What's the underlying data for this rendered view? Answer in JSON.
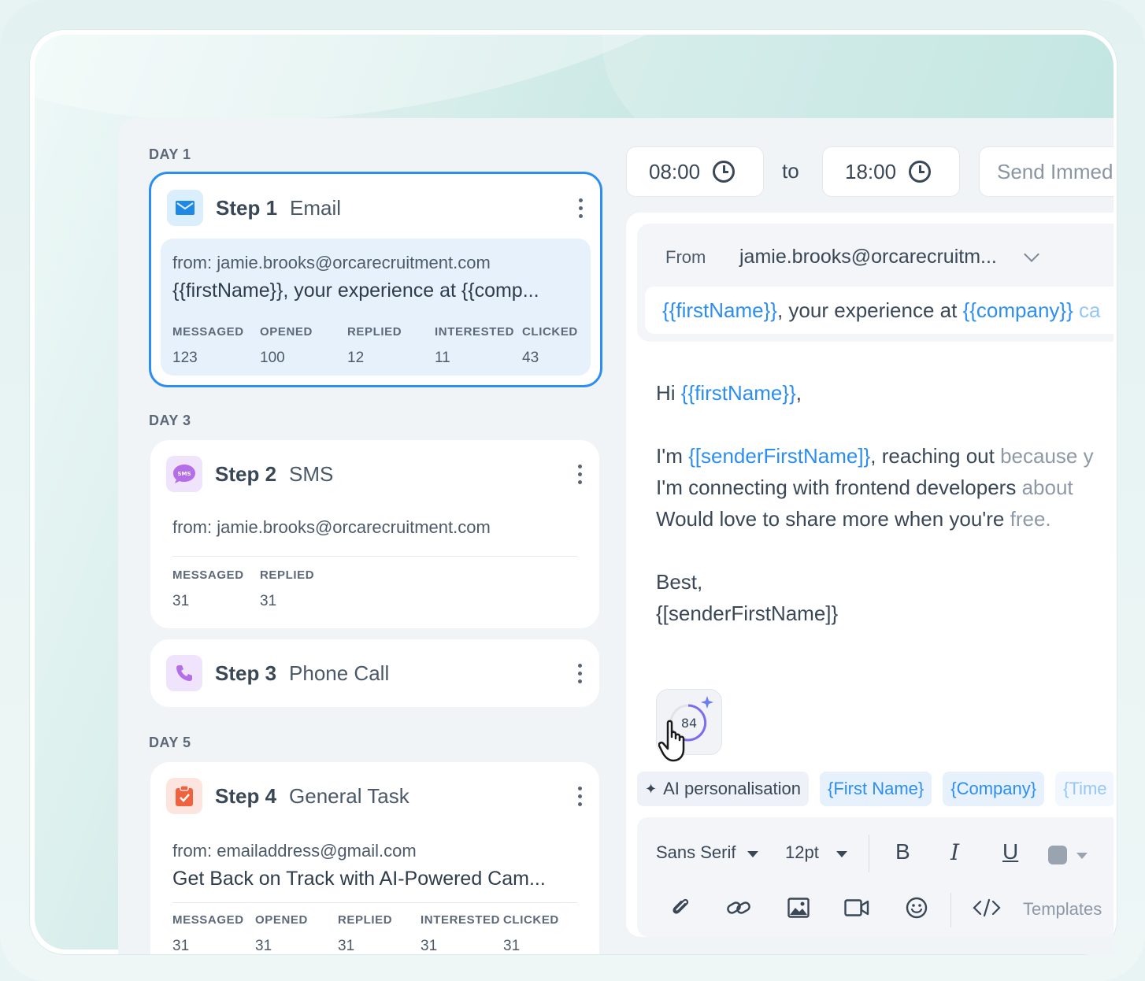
{
  "sequence": {
    "days": [
      "DAY 1",
      "DAY 3",
      "DAY 5"
    ],
    "steps": [
      {
        "title": "Step 1",
        "type": "Email",
        "from": "from:  jamie.brooks@orcarecruitment.com",
        "subject": "{{firstName}}, your experience at {{comp...",
        "stats": [
          {
            "label": "MESSAGED",
            "value": "123"
          },
          {
            "label": "OPENED",
            "value": "100"
          },
          {
            "label": "REPLIED",
            "value": "12"
          },
          {
            "label": "INTERESTED",
            "value": "11"
          },
          {
            "label": "CLICKED",
            "value": "43"
          }
        ]
      },
      {
        "title": "Step 2",
        "type": "SMS",
        "from": "from:  jamie.brooks@orcarecruitment.com",
        "stats": [
          {
            "label": "MESSAGED",
            "value": "31"
          },
          {
            "label": "REPLIED",
            "value": "31"
          }
        ]
      },
      {
        "title": "Step 3",
        "type": "Phone Call"
      },
      {
        "title": "Step 4",
        "type": "General Task",
        "from": "from:  emailaddress@gmail.com",
        "subject": "Get Back on Track with AI-Powered Cam...",
        "stats": [
          {
            "label": "MESSAGED",
            "value": "31"
          },
          {
            "label": "OPENED",
            "value": "31"
          },
          {
            "label": "REPLIED",
            "value": "31"
          },
          {
            "label": "INTERESTED",
            "value": "31"
          },
          {
            "label": "CLICKED",
            "value": "31"
          }
        ]
      }
    ]
  },
  "schedule": {
    "start": "08:00",
    "to": "to",
    "end": "18:00",
    "send": "Send Immediately"
  },
  "editor": {
    "from_label": "From",
    "from_value": "jamie.brooks@orcarecruitm...",
    "subject_var1": "{{firstName}}",
    "subject_mid": ", your experience at ",
    "subject_var2": "{{company}}",
    "subject_tail": " ca",
    "greeting": "Hi ",
    "greeting_var": "{{firstName}}",
    "greeting_end": ",",
    "line1_a": "I'm ",
    "line1_var": "{[senderFirstName]}",
    "line1_b": ", reaching out ",
    "line1_fade": "because y",
    "line2_a": "I'm connecting with frontend developers ",
    "line2_fade": "about",
    "line3_a": "Would love to share more when you're ",
    "line3_fade": "free.",
    "signoff": "Best,",
    "signature_var": "{[senderFirstName]}",
    "score": "84"
  },
  "tags": {
    "ai": "AI personalisation",
    "first_name": "{First Name}",
    "company": "{Company}",
    "time": "{Time"
  },
  "toolbar": {
    "font": "Sans Serif",
    "size": "12pt",
    "bold": "B",
    "italic": "I",
    "underline": "U",
    "templates": "Templates"
  },
  "colors": {
    "accent": "#2c8ef0",
    "email_icon_bg": "#dbeefc",
    "sms_icon_bg": "#efe4fb",
    "task_icon_bg": "#fde5df"
  }
}
